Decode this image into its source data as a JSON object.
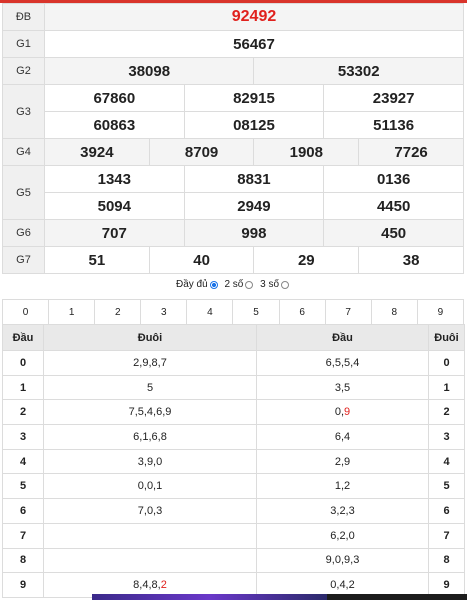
{
  "results": [
    {
      "label": "ĐB",
      "values": [
        "92492"
      ],
      "special": true
    },
    {
      "label": "G1",
      "values": [
        "56467"
      ]
    },
    {
      "label": "G2",
      "values": [
        "38098",
        "53302"
      ]
    },
    {
      "label": "G3",
      "rows": [
        [
          "67860",
          "82915",
          "23927"
        ],
        [
          "60863",
          "08125",
          "51136"
        ]
      ]
    },
    {
      "label": "G4",
      "values": [
        "3924",
        "8709",
        "1908",
        "7726"
      ]
    },
    {
      "label": "G5",
      "rows": [
        [
          "1343",
          "8831",
          "0136"
        ],
        [
          "5094",
          "2949",
          "4450"
        ]
      ]
    },
    {
      "label": "G6",
      "values": [
        "707",
        "998",
        "450"
      ]
    },
    {
      "label": "G7",
      "values": [
        "51",
        "40",
        "29",
        "38"
      ]
    }
  ],
  "display_options": {
    "full_label": "Đầy đủ",
    "two_digit_label": "2 số",
    "three_digit_label": "3 số",
    "selected": "full"
  },
  "digit_filter": [
    "0",
    "1",
    "2",
    "3",
    "4",
    "5",
    "6",
    "7",
    "8",
    "9"
  ],
  "dau_duoi": {
    "headers": [
      "Đầu",
      "Đuôi",
      "Đầu",
      "Đuôi"
    ],
    "rows": [
      {
        "head": "0",
        "tails": "2,9,8,7",
        "heads": "6,5,5,4",
        "tail": "0"
      },
      {
        "head": "1",
        "tails": "5",
        "heads": "3,5",
        "tail": "1"
      },
      {
        "head": "2",
        "tails": "7,5,4,6,9",
        "heads": "0,9",
        "tail": "2"
      },
      {
        "head": "3",
        "tails": "6,1,6,8",
        "heads": "6,4",
        "tail": "3"
      },
      {
        "head": "4",
        "tails": "3,9,0",
        "heads": "2,9",
        "tail": "4"
      },
      {
        "head": "5",
        "tails": "0,0,1",
        "heads": "1,2",
        "tail": "5"
      },
      {
        "head": "6",
        "tails": "7,0,3",
        "heads": "3,2,3",
        "tail": "6"
      },
      {
        "head": "7",
        "tails": "",
        "heads": "6,2,0",
        "tail": "7"
      },
      {
        "head": "8",
        "tails": "",
        "heads": "9,0,9,3",
        "tail": "8"
      },
      {
        "head": "9",
        "tails": "8,4,8,2",
        "heads": "0,4,2",
        "tail": "9"
      }
    ],
    "highlight": {
      "row2_heads_last": "9",
      "row9_tails_last": "2"
    }
  },
  "colors": {
    "accent": "#e0211d",
    "label_bg": "#f0f0f0",
    "header_bg": "#e9e9e9",
    "radio": "#1a73e8"
  }
}
